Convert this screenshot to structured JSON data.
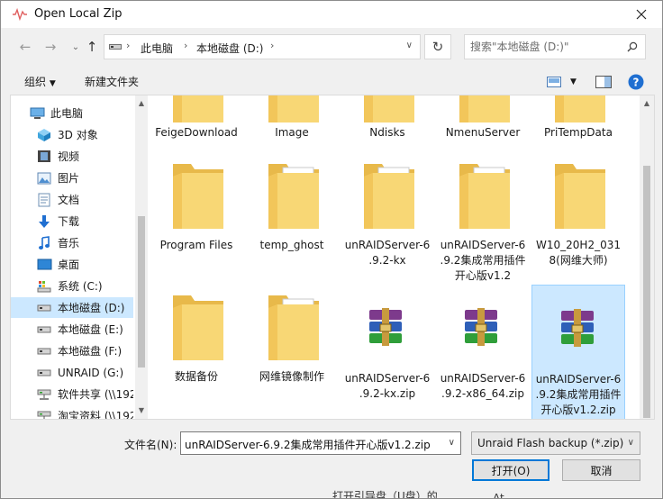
{
  "window": {
    "title": "Open Local Zip"
  },
  "address": {
    "crumbs": [
      "此电脑",
      "本地磁盘 (D:)"
    ]
  },
  "search": {
    "placeholder": "搜索\"本地磁盘 (D:)\""
  },
  "toolbar": {
    "organize": "组织",
    "new_folder": "新建文件夹"
  },
  "nav": {
    "items": [
      {
        "label": "此电脑",
        "icon": "computer-icon"
      },
      {
        "label": "3D 对象",
        "icon": "3d-objects-icon"
      },
      {
        "label": "视频",
        "icon": "video-icon"
      },
      {
        "label": "图片",
        "icon": "pictures-icon"
      },
      {
        "label": "文档",
        "icon": "documents-icon"
      },
      {
        "label": "下载",
        "icon": "download-icon"
      },
      {
        "label": "音乐",
        "icon": "music-icon"
      },
      {
        "label": "桌面",
        "icon": "desktop-icon"
      },
      {
        "label": "系统 (C:)",
        "icon": "system-drive-icon"
      },
      {
        "label": "本地磁盘 (D:)",
        "icon": "drive-icon"
      },
      {
        "label": "本地磁盘 (E:)",
        "icon": "drive-icon"
      },
      {
        "label": "本地磁盘 (F:)",
        "icon": "drive-icon"
      },
      {
        "label": "UNRAID (G:)",
        "icon": "drive-icon"
      },
      {
        "label": "软件共享 (\\\\192",
        "icon": "network-drive-icon"
      },
      {
        "label": "淘宝资料 (\\\\192",
        "icon": "network-drive-icon"
      }
    ],
    "selected_index": 9
  },
  "files": {
    "row1": [
      {
        "name": "FeigeDownload",
        "type": "folder"
      },
      {
        "name": "Image",
        "type": "folder"
      },
      {
        "name": "Ndisks",
        "type": "folder"
      },
      {
        "name": "NmenuServer",
        "type": "folder"
      },
      {
        "name": "PriTempData",
        "type": "folder"
      }
    ],
    "row2": [
      {
        "name_lines": [
          "Program Files"
        ],
        "type": "folder"
      },
      {
        "name_lines": [
          "temp_ghost"
        ],
        "type": "folder-doc"
      },
      {
        "name_lines": [
          "unRAIDServer-6",
          ".9.2-kx"
        ],
        "type": "folder-doc"
      },
      {
        "name_lines": [
          "unRAIDServer-6",
          ".9.2集成常用插件",
          "开心版v1.2"
        ],
        "type": "folder-doc"
      },
      {
        "name_lines": [
          "W10_20H2_031",
          "8(网维大师)"
        ],
        "type": "folder"
      }
    ],
    "row3": [
      {
        "name_lines": [
          "数据备份"
        ],
        "type": "folder"
      },
      {
        "name_lines": [
          "网维镜像制作"
        ],
        "type": "folder-doc"
      },
      {
        "name_lines": [
          "unRAIDServer-6",
          ".9.2-kx.zip"
        ],
        "type": "zip"
      },
      {
        "name_lines": [
          "unRAIDServer-6",
          ".9.2-x86_64.zip"
        ],
        "type": "zip"
      },
      {
        "name_lines": [
          "unRAIDServer-6",
          ".9.2集成常用插件",
          "开心版v1.2.zip"
        ],
        "type": "zip",
        "selected": true
      }
    ]
  },
  "bottom": {
    "filename_label": "文件名(N):",
    "filename_value": "unRAIDServer-6.9.2集成常用插件开心版v1.2.zip",
    "filetype": "Unraid Flash backup (*.zip)",
    "open": "打开(O)",
    "cancel": "取消"
  },
  "behind": {
    "text1": "打开引导盘（U盘）的",
    "text2": "At..."
  },
  "colors": {
    "selection": "#cce8ff",
    "folder": "#f8d775",
    "accent": "#0078d7"
  }
}
